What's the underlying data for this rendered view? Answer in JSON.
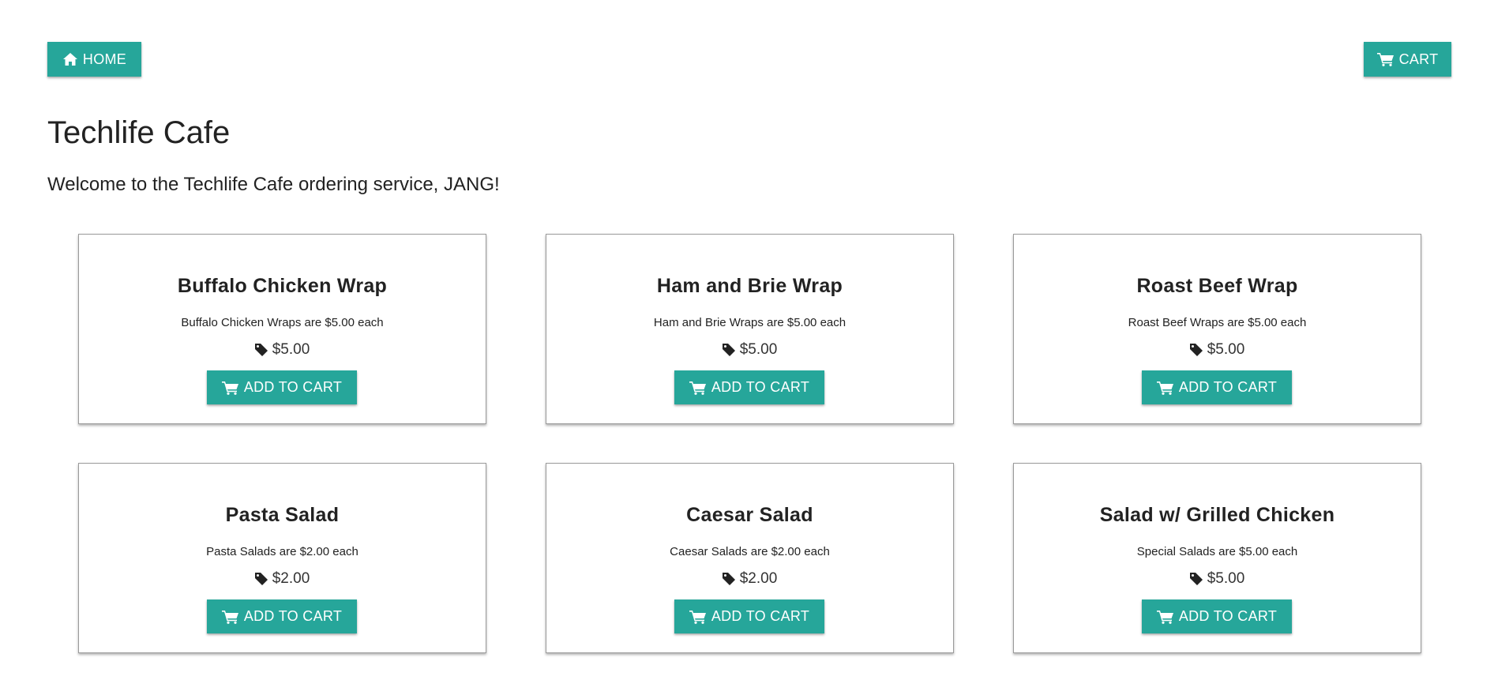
{
  "nav": {
    "home_label": "HOME",
    "cart_label": "CART"
  },
  "header": {
    "title": "Techlife Cafe",
    "welcome": "Welcome to the Techlife Cafe ordering service, JANG!"
  },
  "products": [
    {
      "name": "Buffalo Chicken Wrap",
      "description": "Buffalo Chicken Wraps are $5.00 each",
      "price": "$5.00",
      "button": "ADD TO CART"
    },
    {
      "name": "Ham and Brie Wrap",
      "description": "Ham and Brie Wraps are $5.00 each",
      "price": "$5.00",
      "button": "ADD TO CART"
    },
    {
      "name": "Roast Beef Wrap",
      "description": "Roast Beef Wraps are $5.00 each",
      "price": "$5.00",
      "button": "ADD TO CART"
    },
    {
      "name": "Pasta Salad",
      "description": "Pasta Salads are $2.00 each",
      "price": "$2.00",
      "button": "ADD TO CART"
    },
    {
      "name": "Caesar Salad",
      "description": "Caesar Salads are $2.00 each",
      "price": "$2.00",
      "button": "ADD TO CART"
    },
    {
      "name": "Salad w/ Grilled Chicken",
      "description": "Special Salads are $5.00 each",
      "price": "$5.00",
      "button": "ADD TO CART"
    }
  ],
  "icons": {
    "home": "home-icon",
    "cart": "cart-icon",
    "price_tag": "tag-icon"
  },
  "colors": {
    "accent": "#26a69a",
    "text": "#222222",
    "card_border": "#9a9a9a"
  }
}
